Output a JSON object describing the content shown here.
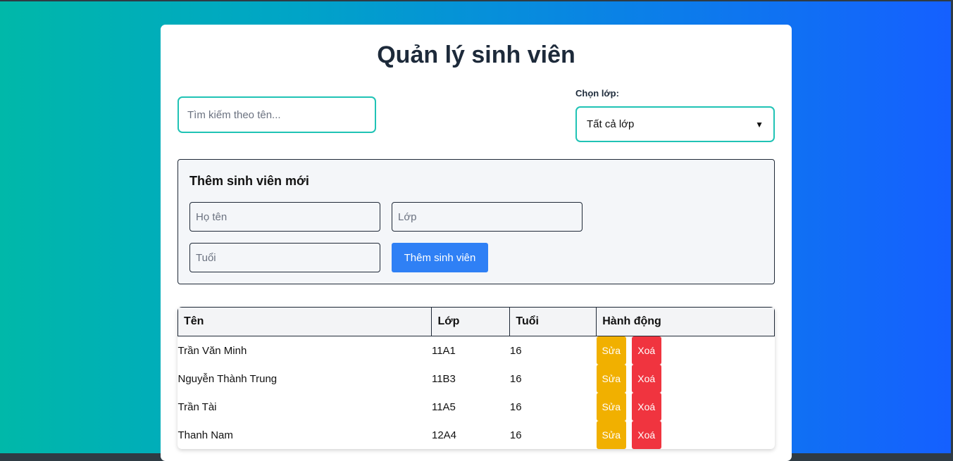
{
  "page": {
    "title": "Quản lý sinh viên"
  },
  "search": {
    "placeholder": "Tìm kiếm theo tên..."
  },
  "class_filter": {
    "label": "Chọn lớp:",
    "selected": "Tất cả lớp"
  },
  "add_form": {
    "title": "Thêm sinh viên mới",
    "name_placeholder": "Họ tên",
    "class_placeholder": "Lớp",
    "age_placeholder": "Tuổi",
    "submit_label": "Thêm sinh viên"
  },
  "table": {
    "headers": [
      "Tên",
      "Lớp",
      "Tuổi",
      "Hành động"
    ],
    "rows": [
      {
        "name": "Trần Văn Minh",
        "class": "11A1",
        "age": "16"
      },
      {
        "name": "Nguyễn Thành Trung",
        "class": "11B3",
        "age": "16"
      },
      {
        "name": "Trần Tài",
        "class": "11A5",
        "age": "16"
      },
      {
        "name": "Thanh Nam",
        "class": "12A4",
        "age": "16"
      }
    ],
    "edit_label": "Sửa",
    "delete_label": "Xoá"
  },
  "colors": {
    "accent": "#20c3b5",
    "primary_button": "#2f80f5",
    "edit_button": "#f1b000",
    "delete_button": "#f0343f"
  }
}
